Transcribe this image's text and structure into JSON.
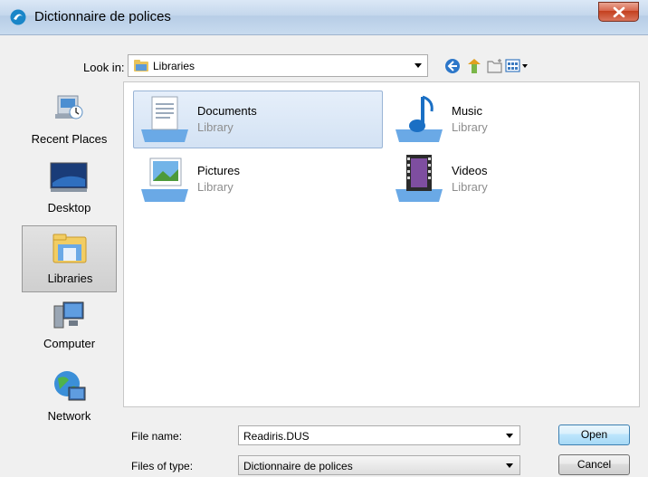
{
  "window": {
    "title": "Dictionnaire de polices"
  },
  "lookin": {
    "label": "Look in:",
    "value": "Libraries"
  },
  "toolbar": {
    "icons": [
      "back-icon",
      "up-folder-icon",
      "new-folder-icon",
      "view-menu-icon"
    ]
  },
  "places": [
    {
      "label": "Recent Places",
      "icon": "recent-places-icon"
    },
    {
      "label": "Desktop",
      "icon": "desktop-icon"
    },
    {
      "label": "Libraries",
      "icon": "libraries-icon",
      "selected": true
    },
    {
      "label": "Computer",
      "icon": "computer-icon"
    },
    {
      "label": "Network",
      "icon": "network-icon"
    }
  ],
  "files": [
    {
      "name": "Documents",
      "type": "Library",
      "icon": "documents-library-icon",
      "selected": true
    },
    {
      "name": "Music",
      "type": "Library",
      "icon": "music-library-icon"
    },
    {
      "name": "Pictures",
      "type": "Library",
      "icon": "pictures-library-icon"
    },
    {
      "name": "Videos",
      "type": "Library",
      "icon": "videos-library-icon"
    }
  ],
  "filename": {
    "label": "File name:",
    "value": "Readiris.DUS"
  },
  "filetype": {
    "label": "Files of type:",
    "value": "Dictionnaire de polices"
  },
  "buttons": {
    "open": "Open",
    "cancel": "Cancel"
  }
}
